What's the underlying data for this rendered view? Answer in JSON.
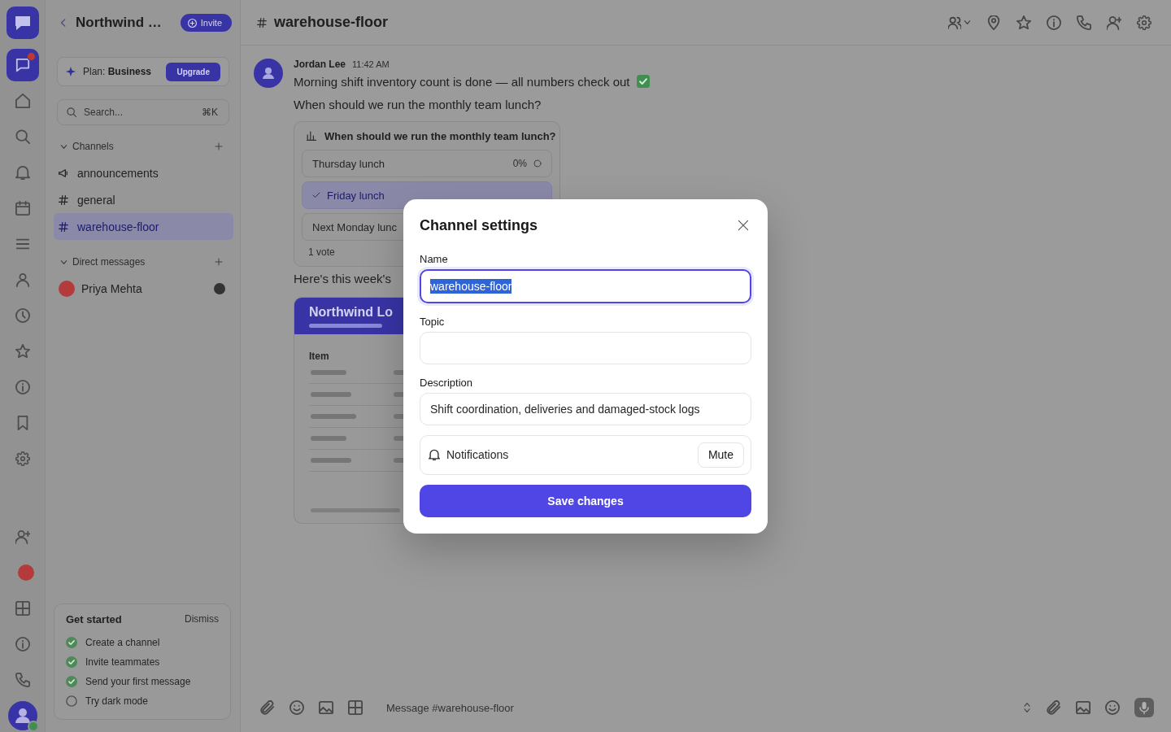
{
  "rail": {
    "items": [
      {
        "kind": "nav",
        "selected": true,
        "badge": true
      },
      {
        "kind": "nav",
        "selected": false,
        "badge": false
      },
      {
        "kind": "nav",
        "selected": false,
        "badge": false
      },
      {
        "kind": "nav",
        "selected": false,
        "badge": false
      },
      {
        "kind": "nav",
        "selected": false,
        "badge": false
      },
      {
        "kind": "nav",
        "selected": false,
        "badge": false
      },
      {
        "kind": "nav",
        "selected": false,
        "badge": false
      },
      {
        "kind": "nav",
        "selected": false,
        "badge": false
      },
      {
        "kind": "nav",
        "selected": false,
        "badge": false
      },
      {
        "kind": "nav",
        "selected": false,
        "badge": false
      },
      {
        "kind": "nav",
        "selected": false,
        "badge": false
      },
      {
        "kind": "nav",
        "selected": false,
        "badge": false
      }
    ],
    "bottom": [
      {
        "kind": "nav",
        "selected": false
      },
      {
        "kind": "avatar",
        "selected": false
      },
      {
        "kind": "nav",
        "selected": false
      },
      {
        "kind": "nav",
        "selected": false
      },
      {
        "kind": "nav",
        "selected": false
      }
    ],
    "user": {
      "online": true
    }
  },
  "sidebar": {
    "workspace": "Northwind …",
    "invite": "Invite",
    "plan": {
      "text": "Plan: **Business**",
      "action": "Upgrade"
    },
    "search": {
      "placeholder": "Search...",
      "shortcut": "⌘K"
    },
    "sections": [
      {
        "title": "Channels",
        "expanded": true,
        "items": [
          {
            "kind": "announcement",
            "label": "announcements",
            "selected": false,
            "unread": false
          },
          {
            "kind": "channel",
            "label": "general",
            "selected": false,
            "unread": false
          },
          {
            "kind": "channel",
            "label": "warehouse-floor",
            "selected": true,
            "unread": false
          }
        ]
      },
      {
        "title": "Direct messages",
        "expanded": true,
        "items": [
          {
            "kind": "dm",
            "label": "Priya Mehta",
            "selected": false,
            "unread": true
          }
        ]
      }
    ],
    "checklist": {
      "title": "Get started",
      "dismiss": "Dismiss",
      "items": [
        {
          "label": "Create a channel",
          "done": true
        },
        {
          "label": "Invite teammates",
          "done": true
        },
        {
          "label": "Send your first message",
          "done": true
        },
        {
          "label": "Try dark mode",
          "done": false
        }
      ]
    }
  },
  "channel": {
    "name": "warehouse-floor"
  },
  "messages": [
    {
      "author": "Jordan Lee",
      "time": "11:42 AM",
      "blocks": [
        {
          "kind": "text",
          "text": "Morning shift inventory count is done — all numbers check out",
          "emoji": true
        },
        {
          "kind": "text",
          "text": "When should we run the monthly team lunch?",
          "emoji": false
        },
        {
          "kind": "poll",
          "question": "When should we run the monthly team lunch?",
          "options": [
            {
              "label": "Thursday lunch",
              "percent": "0%",
              "selected": false
            },
            {
              "label": "Friday lunch",
              "selected": true
            },
            {
              "label": "Next Monday lunc",
              "selected": false
            }
          ],
          "votes": "1 vote"
        },
        {
          "kind": "text",
          "text": "Here's this week's",
          "emoji": false
        },
        {
          "kind": "report",
          "title": "Northwind Lo",
          "columns": [
            "Item"
          ]
        }
      ]
    }
  ],
  "composer": {
    "placeholder": "Message #warehouse-floor"
  },
  "dialog": {
    "title": "Channel settings",
    "fields": [
      {
        "label": "Name",
        "value": "warehouse-floor",
        "focused": true,
        "text_selected": true
      },
      {
        "label": "Topic",
        "focused": false
      },
      {
        "label": "Description",
        "value": "Shift coordination, deliveries and damaged-stock logs",
        "focused": false,
        "text_selected": false
      }
    ],
    "notifications": {
      "label": "Notifications",
      "action": "Mute"
    },
    "submit": "Save changes"
  }
}
